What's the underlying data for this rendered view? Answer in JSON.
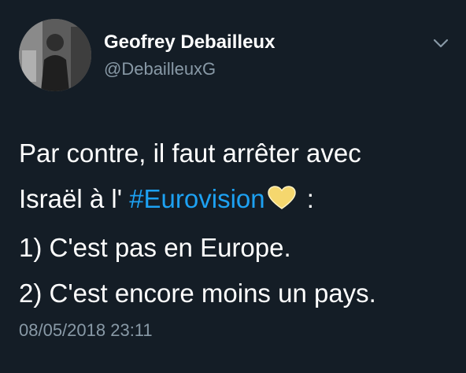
{
  "author": {
    "display_name": "Geofrey Debailleux",
    "handle": "@DebailleuxG"
  },
  "icons": {
    "menu": "chevron-down-icon",
    "emoji": "yellow-heart-icon"
  },
  "tweet": {
    "line1": "Par contre, il faut arrêter avec",
    "line2_prefix": "Israël à l' ",
    "hashtag": "#Eurovision",
    "line2_suffix": " :",
    "line3": "1) C'est pas en Europe.",
    "line4": "2) C'est encore moins un pays."
  },
  "timestamp": "08/05/2018 23:11",
  "colors": {
    "background": "#141d26",
    "link": "#1da1f2",
    "secondary_text": "#8899a6",
    "heart": "#f5d76e"
  }
}
